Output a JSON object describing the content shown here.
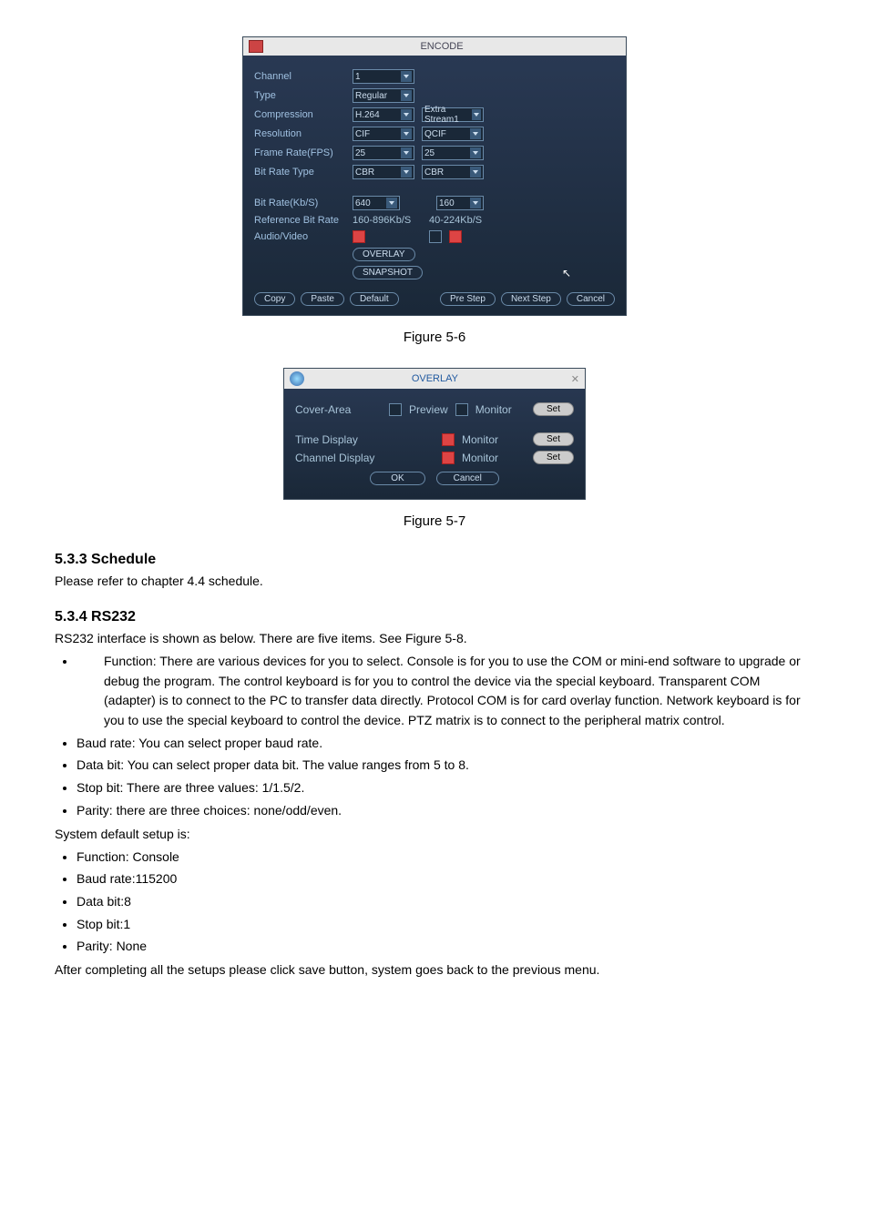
{
  "encode": {
    "title": "ENCODE",
    "labels": {
      "channel": "Channel",
      "type": "Type",
      "compression": "Compression",
      "resolution": "Resolution",
      "frame_rate": "Frame Rate(FPS)",
      "bit_rate_type": "Bit Rate Type",
      "bit_rate": "Bit Rate(Kb/S)",
      "reference_bit_rate": "Reference Bit Rate",
      "audio_video": "Audio/Video"
    },
    "left": {
      "channel": "1",
      "type": "Regular",
      "compression": "H.264",
      "resolution": "CIF",
      "fps": "25",
      "brtype": "CBR",
      "bitrate": "640",
      "refbr": "160-896Kb/S"
    },
    "right": {
      "compression": "Extra Stream1",
      "resolution": "QCIF",
      "fps": "25",
      "brtype": "CBR",
      "bitrate": "160",
      "refbr": "40-224Kb/S"
    },
    "buttons": {
      "overlay": "OVERLAY",
      "snapshot": "SNAPSHOT",
      "copy": "Copy",
      "paste": "Paste",
      "default": "Default",
      "prestep": "Pre Step",
      "nextstep": "Next Step",
      "cancel": "Cancel"
    }
  },
  "fig56": "Figure 5-6",
  "overlay": {
    "title": "OVERLAY",
    "cover_area": "Cover-Area",
    "preview": "Preview",
    "monitor": "Monitor",
    "time_display": "Time Display",
    "channel_display": "Channel Display",
    "set": "Set",
    "ok": "OK",
    "cancel": "Cancel"
  },
  "fig57": "Figure 5-7",
  "schedule": {
    "heading": "5.3.3  Schedule",
    "body": "Please refer to chapter 4.4 schedule."
  },
  "rs232": {
    "heading": "5.3.4  RS232",
    "intro": "RS232 interface is shown as below. There are five items. See Figure 5-8.",
    "bullets": [
      " Function: There are various devices for you to select. Console is for you to use the COM or mini-end software to upgrade or debug the program. The control keyboard is for you to control the device via the special keyboard. Transparent COM (adapter) is to connect to the PC to transfer data directly. Protocol COM is for card overlay function. Network keyboard is for you to use the special keyboard to control the device. PTZ matrix is to connect to the peripheral matrix control.",
      "Baud rate: You can select proper baud rate.",
      "Data bit: You can select proper data bit. The value ranges from 5 to 8.",
      "Stop bit: There are three values: 1/1.5/2.",
      "Parity: there are three choices: none/odd/even."
    ],
    "default_intro": "System default setup is:",
    "defaults": [
      "Function: Console",
      "Baud rate:115200",
      "Data bit:8",
      "Stop bit:1",
      "Parity: None"
    ],
    "after": "After completing all the setups please click save button, system goes back to the previous menu."
  }
}
